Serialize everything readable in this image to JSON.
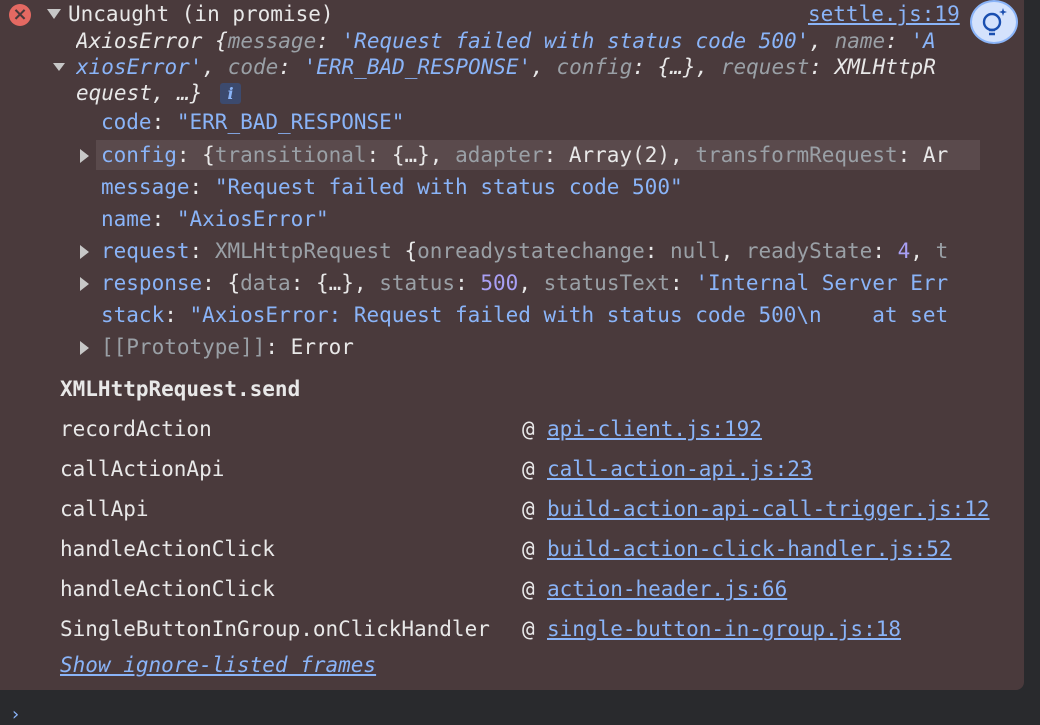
{
  "console": {
    "header": {
      "title": "Uncaught (in promise)",
      "source_link": "settle.js:19"
    },
    "summary": {
      "line1_prefix": "AxiosError {",
      "line1_k1": "message",
      "line1_v1": "'Request failed with status code 500'",
      "line1_sep1": ", ",
      "line1_k2": "name",
      "line1_v2_start": "'A",
      "line2_v2_end": "xiosError'",
      "line2_sep": ", ",
      "line2_k3": "code",
      "line2_v3": "'ERR_BAD_RESPONSE'",
      "line2_k4": "config",
      "line2_v4": "{…}",
      "line2_k5": "request",
      "line2_v5_start": "XMLHttpR",
      "line3_v5_end": "equest",
      "line3_rest": ", …}",
      "info_badge": "i"
    },
    "properties": {
      "code_key": "code",
      "code_val": "\"ERR_BAD_RESPONSE\"",
      "config_key": "config",
      "config_open": "{",
      "config_k1": "transitional",
      "config_v1": "{…}",
      "config_k2": "adapter",
      "config_v2": "Array(2)",
      "config_k3": "transformRequest",
      "config_v3": "Ar",
      "message_key": "message",
      "message_val": "\"Request failed with status code 500\"",
      "name_key": "name",
      "name_val": "\"AxiosError\"",
      "request_key": "request",
      "request_type": "XMLHttpRequest",
      "request_open": "{",
      "request_k1": "onreadystatechange",
      "request_v1": "null",
      "request_k2": "readyState",
      "request_v2": "4",
      "request_k3": "t",
      "response_key": "response",
      "response_open": "{",
      "response_k1": "data",
      "response_v1": "{…}",
      "response_k2": "status",
      "response_v2": "500",
      "response_k3": "statusText",
      "response_v3": "'Internal Server Err",
      "stack_key": "stack",
      "stack_val": "\"AxiosError: Request failed with status code 500\\n    at set",
      "prototype_key": "[[Prototype]]",
      "prototype_val": "Error",
      "colon": ": "
    },
    "call_stack": {
      "heading": "XMLHttpRequest.send",
      "at_symbol": "@",
      "frames": [
        {
          "fn": "recordAction",
          "link": "api-client.js:192"
        },
        {
          "fn": "callActionApi",
          "link": "call-action-api.js:23"
        },
        {
          "fn": "callApi",
          "link": "build-action-api-call-trigger.js:12"
        },
        {
          "fn": "handleActionClick",
          "link": "build-action-click-handler.js:52"
        },
        {
          "fn": "handleActionClick",
          "link": "action-header.js:66"
        },
        {
          "fn": "SingleButtonInGroup.onClickHandler",
          "link": "single-button-in-group.js:18"
        }
      ],
      "show_ignored": "Show ignore-listed frames"
    },
    "prompt_symbol": "›"
  },
  "icons": {
    "error": "error-circle-icon",
    "insights": "lightbulb-sparkle-icon"
  },
  "colors": {
    "error_bg": "#4a3a3c",
    "link": "#8ab4f8",
    "number": "#a9a0f5",
    "error_icon": "#e46962"
  }
}
